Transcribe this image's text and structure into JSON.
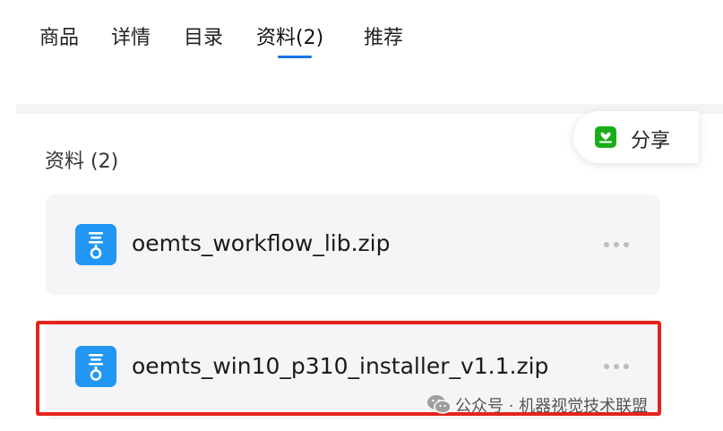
{
  "tabs": [
    {
      "label": "商品",
      "active": false
    },
    {
      "label": "详情",
      "active": false
    },
    {
      "label": "目录",
      "active": false
    },
    {
      "label": "资料(2)",
      "active": true
    },
    {
      "label": "推荐",
      "active": false
    }
  ],
  "share": {
    "label": "分享",
    "icon": "share-icon"
  },
  "section": {
    "title": "资料 (2)"
  },
  "files": [
    {
      "name": "oemts_workflow_lib.zip",
      "icon": "zip-file-icon",
      "more_icon": "more-icon"
    },
    {
      "name": "oemts_win10_p310_installer_v1.1.zip",
      "icon": "zip-file-icon",
      "more_icon": "more-icon"
    }
  ],
  "watermark": {
    "text": "公众号 · 机器视觉技术联盟",
    "icon": "wechat-icon"
  },
  "colors": {
    "accent": "#1a73e8",
    "file_icon": "#2196f3",
    "share_icon": "#1aad19",
    "highlight": "#e5231c",
    "card_bg": "#f5f5f7"
  }
}
